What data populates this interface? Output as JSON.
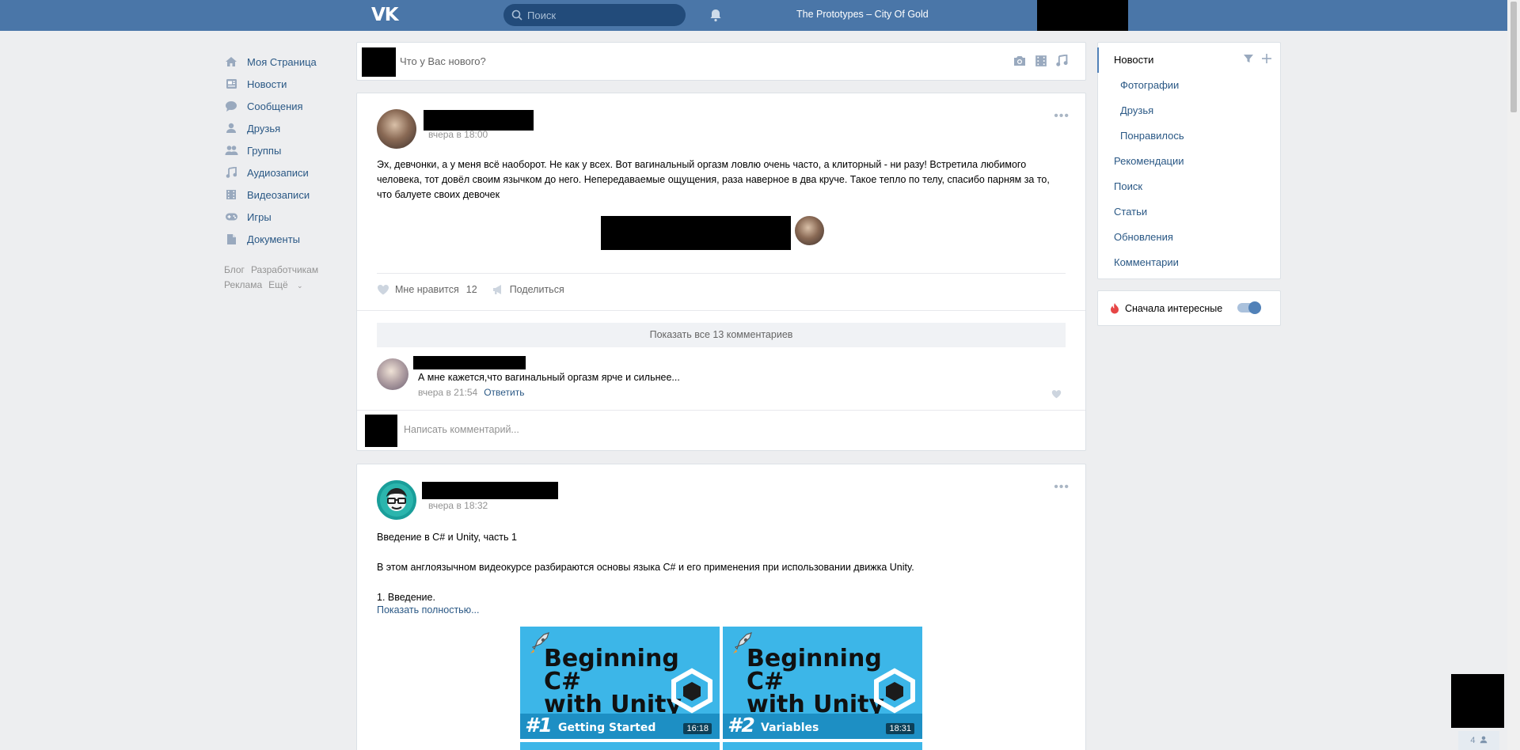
{
  "header": {
    "logo": "VK",
    "search_placeholder": "Поиск",
    "track": "The Prototypes – City Of Gold"
  },
  "leftnav": {
    "items": [
      {
        "label": "Моя Страница",
        "icon": "home-icon"
      },
      {
        "label": "Новости",
        "icon": "news-icon"
      },
      {
        "label": "Сообщения",
        "icon": "messages-icon"
      },
      {
        "label": "Друзья",
        "icon": "friends-icon"
      },
      {
        "label": "Группы",
        "icon": "groups-icon"
      },
      {
        "label": "Аудиозаписи",
        "icon": "music-icon"
      },
      {
        "label": "Видеозаписи",
        "icon": "video-icon"
      },
      {
        "label": "Игры",
        "icon": "gamepad-icon"
      },
      {
        "label": "Документы",
        "icon": "document-icon"
      }
    ],
    "footer": [
      "Блог",
      "Разработчикам",
      "Реклама",
      "Ещё"
    ]
  },
  "composer": {
    "placeholder": "Что у Вас нового?"
  },
  "post1": {
    "time": "вчера в 18:00",
    "text": "Эх, девчонки, а у меня всё наоборот. Не как у всех. Вот вагинальный оргазм ловлю очень часто, а клиторный - ни разу! Встретила любимого человека, тот довёл своим язычком до него. Непередаваемые ощущения, раза наверное в два круче. Такое тепло по телу, спасибо парням за то, что балуете своих девочек",
    "like_label": "Мне нравится",
    "like_count": "12",
    "share_label": "Поделиться",
    "show_comments": "Показать все 13 комментариев",
    "comment": {
      "text": "А мне кажется,что вагинальный оргазм ярче и сильнее...",
      "time": "вчера в 21:54",
      "reply": "Ответить"
    },
    "write_placeholder": "Написать комментарий..."
  },
  "post2": {
    "time": "вчера в 18:32",
    "line1": "Введение в C# и Unity, часть 1",
    "line2": "В этом англоязычном видеокурсе разбираются основы языка C# и его применения при использовании движка Unity.",
    "line3": "1. Введение.",
    "show_full": "Показать полностью...",
    "videos": [
      {
        "title_line1": "Beginning C#",
        "title_line2": "with Unity",
        "num": "#1",
        "subtitle": "Getting Started",
        "duration": "16:18"
      },
      {
        "title_line1": "Beginning C#",
        "title_line2": "with Unity",
        "num": "#2",
        "subtitle": "Variables",
        "duration": "18:31"
      }
    ]
  },
  "rightmenu": {
    "items": [
      "Новости",
      "Фотографии",
      "Друзья",
      "Понравилось",
      "Рекомендации",
      "Поиск",
      "Статьи",
      "Обновления",
      "Комментарии"
    ],
    "toggle_label": "Сначала интересные",
    "toggle_on": true
  },
  "corner": {
    "people_count": "4"
  },
  "colors": {
    "brand": "#4a76a8",
    "link": "#2a5885",
    "bg": "#edeef0"
  }
}
